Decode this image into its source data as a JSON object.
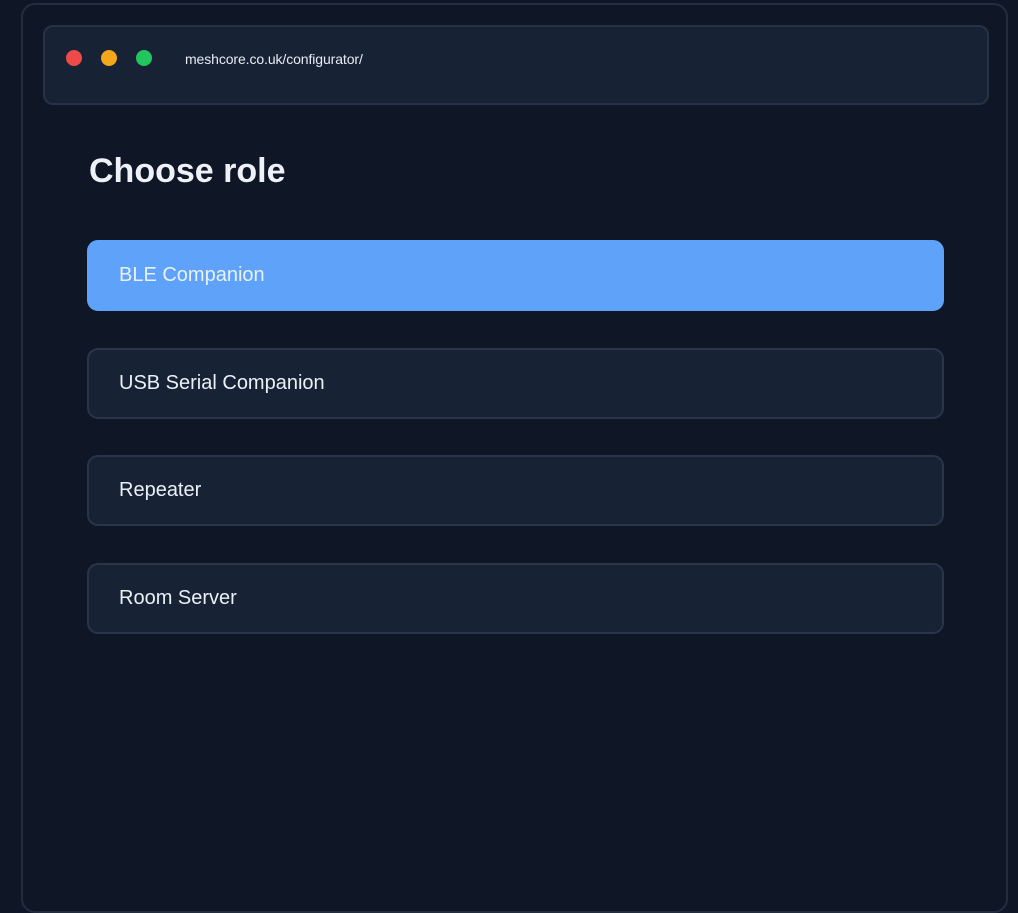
{
  "browser": {
    "url": "meshcore.co.uk/configurator/",
    "dots": [
      {
        "name": "close",
        "color": "#ee4a49"
      },
      {
        "name": "minimize",
        "color": "#f4a61d"
      },
      {
        "name": "maximize",
        "color": "#23c55e"
      }
    ]
  },
  "page": {
    "title": "Choose role"
  },
  "roles": [
    {
      "label": "BLE Companion",
      "selected": true
    },
    {
      "label": "USB Serial Companion",
      "selected": false
    },
    {
      "label": "Repeater",
      "selected": false
    },
    {
      "label": "Room Server",
      "selected": false
    }
  ],
  "colors": {
    "background": "#0f1626",
    "card": "#172234",
    "border": "#28354a",
    "accent": "#5ea2f9",
    "text": "#eaf0f7"
  }
}
